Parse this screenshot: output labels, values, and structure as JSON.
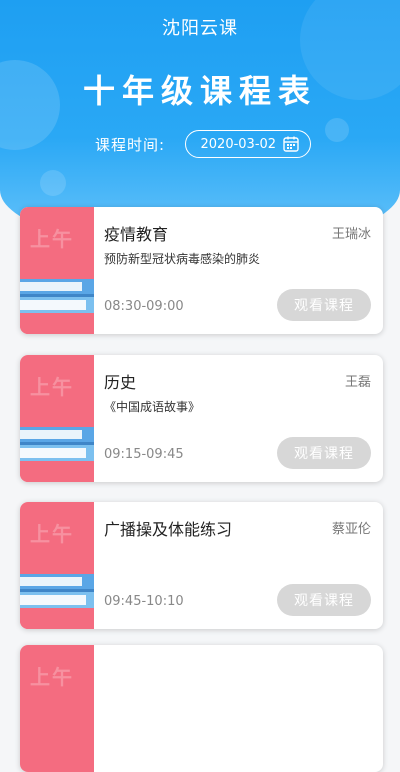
{
  "app_title": "沈阳云课",
  "page_title": "十年级课程表",
  "date_label": "课程时间:",
  "date_value": "2020-03-02",
  "colors": {
    "header_blue": "#1e9ff2",
    "card_pink": "#f46c80",
    "button_gray": "#d7d7d7"
  },
  "courses": [
    {
      "period": "上午",
      "name": "疫情教育",
      "teacher": "王瑞冰",
      "desc": "预防新型冠状病毒感染的肺炎",
      "time": "08:30-09:00",
      "button": "观看课程"
    },
    {
      "period": "上午",
      "name": "历史",
      "teacher": "王磊",
      "desc": "《中国成语故事》",
      "time": "09:15-09:45",
      "button": "观看课程"
    },
    {
      "period": "上午",
      "name": "广播操及体能练习",
      "teacher": "蔡亚伦",
      "desc": "",
      "time": "09:45-10:10",
      "button": "观看课程"
    },
    {
      "period": "上午",
      "name": "",
      "teacher": "",
      "desc": "",
      "time": "",
      "button": ""
    }
  ]
}
